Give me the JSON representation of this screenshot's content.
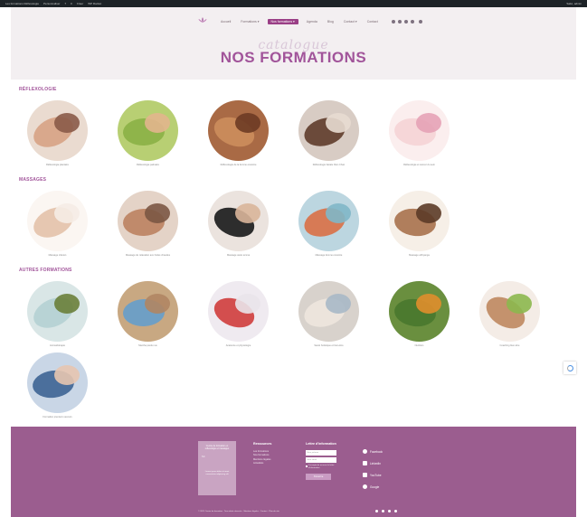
{
  "admin_bar": {
    "items": [
      "Les formations Réflexologie",
      "Personnaliser",
      "7",
      "0",
      "Créer",
      "WP Rocket"
    ],
    "right": "Salut, admin"
  },
  "nav": {
    "items": [
      "Accueil",
      "Formations ▾",
      "Nos formations ▾",
      "Agenda",
      "Blog",
      "Contact ▾",
      "Contact"
    ],
    "active_index": 2
  },
  "header": {
    "script_title": "catalogue",
    "title": "NOS FORMATIONS"
  },
  "sections": [
    {
      "title": "RÉFLEXOLOGIE",
      "cards": [
        {
          "caption": "Réflexologie plantaire",
          "c1": "#d9a88c",
          "c2": "#8a5a48",
          "bg": "#eadbd0"
        },
        {
          "caption": "Réflexologie palmaire",
          "c1": "#8fb44a",
          "c2": "#e2b58d",
          "bg": "#b8cf73"
        },
        {
          "caption": "Réflexologie de la femme enceinte",
          "c1": "#c98a5a",
          "c2": "#6d3b23",
          "bg": "#a96a45"
        },
        {
          "caption": "Réflexologie faciale Dien Chan",
          "c1": "#6b4a3a",
          "c2": "#e8dcd2",
          "bg": "#d8ccc4"
        },
        {
          "caption": "Réflexologie et cancer du sein",
          "c1": "#f6d6d8",
          "c2": "#e6a2b6",
          "bg": "#fbeeee"
        }
      ]
    },
    {
      "title": "MASSAGES",
      "cards": [
        {
          "caption": "Massage crânien",
          "c1": "#e6c7b1",
          "c2": "#f5ece6",
          "bg": "#fbf6f2"
        },
        {
          "caption": "Massage de relaxation aux huiles chaudes",
          "c1": "#c08a6b",
          "c2": "#7b5644",
          "bg": "#e4d3c7"
        },
        {
          "caption": "Massage assis amma",
          "c1": "#2d2d2d",
          "c2": "#d9b59a",
          "bg": "#ebe3de"
        },
        {
          "caption": "Massage femme enceinte",
          "c1": "#d77a55",
          "c2": "#80b7c8",
          "bg": "#bcd6e0"
        },
        {
          "caption": "Massage abhyanga",
          "c1": "#b07e5c",
          "c2": "#5c3b27",
          "bg": "#f6efe7"
        }
      ]
    },
    {
      "title": "AUTRES FORMATIONS",
      "cards": [
        {
          "caption": "Aromathérapie",
          "c1": "#b8d3d5",
          "c2": "#6a7f3a",
          "bg": "#d9e6e6"
        },
        {
          "caption": "Marche pieds nus",
          "c1": "#6f9fc4",
          "c2": "#b08563",
          "bg": "#c8a882"
        },
        {
          "caption": "Anatomie et physiologie",
          "c1": "#d34e4e",
          "c2": "#e9e4ea",
          "bg": "#efeaf0"
        },
        {
          "caption": "Santé holistique et bien-être",
          "c1": "#ece4dc",
          "c2": "#a8b8c6",
          "bg": "#d8d2cc"
        },
        {
          "caption": "Nutrition",
          "c1": "#4c7a2f",
          "c2": "#e08e2c",
          "bg": "#6a8f3f"
        },
        {
          "caption": "Coaching bien-être",
          "c1": "#c4926d",
          "c2": "#8cb84e",
          "bg": "#f4ece6"
        },
        {
          "caption": "Formation premiers secours",
          "c1": "#4b6f9c",
          "c2": "#e7c5b0",
          "bg": "#c9d6e6"
        }
      ]
    }
  ],
  "footer": {
    "box_title": "Centre de formation en réflexologie et massages",
    "box_small": "Tél",
    "box_text": "Lorem ipsum dolor sit amet consectetur adipiscing elit",
    "col1_title": "Ressources",
    "col1_links": [
      "Les formations",
      "Nos formations",
      "Mentions légales",
      "Actualités"
    ],
    "newsletter_title": "Lettre d'information",
    "nl_placeholder_1": "Votre prénom",
    "nl_placeholder_2": "Votre email",
    "nl_consent": "J'accepte de recevoir la lettre d'information",
    "nl_button": "S'inscrire",
    "socials": [
      "Facebook",
      "LinkedIn",
      "YouTube",
      "Google"
    ],
    "bottom": "© 2021 Centre de formation · Tous droits réservés · Mentions légales · Contact · Plan du site"
  }
}
